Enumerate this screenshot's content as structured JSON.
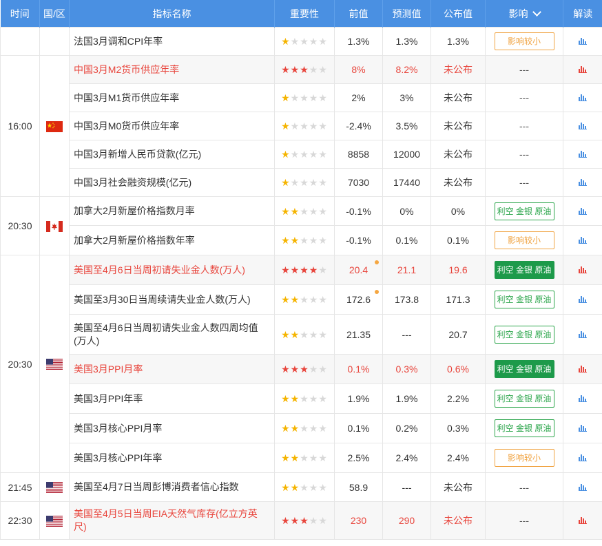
{
  "header": {
    "time": "时间",
    "region": "国/区",
    "name": "指标名称",
    "importance": "重要性",
    "previous": "前值",
    "forecast": "预测值",
    "actual": "公布值",
    "impact": "影响",
    "interpret": "解读"
  },
  "groups": [
    {
      "time": "16:00",
      "flag": "china-flag"
    },
    {
      "time": "20:30",
      "flag": "canada-flag"
    },
    {
      "time": "20:30",
      "flag": "us-flag"
    },
    {
      "time": "21:45",
      "flag": "us-flag"
    },
    {
      "time": "22:30",
      "flag": "us-flag"
    }
  ],
  "rows": [
    {
      "name": "法国3月调和CPI年率",
      "stars": 1,
      "prev": "1.3%",
      "fc": "1.3%",
      "act": "1.3%",
      "impact": "影响较小",
      "impact_style": "small",
      "hi": false
    },
    {
      "name": "中国3月M2货币供应年率",
      "stars": 3,
      "prev": "8%",
      "fc": "8.2%",
      "act": "未公布",
      "impact": "---",
      "impact_style": "none",
      "hi": true
    },
    {
      "name": "中国3月M1货币供应年率",
      "stars": 1,
      "prev": "2%",
      "fc": "3%",
      "act": "未公布",
      "impact": "---",
      "impact_style": "none",
      "hi": false
    },
    {
      "name": "中国3月M0货币供应年率",
      "stars": 1,
      "prev": "-2.4%",
      "fc": "3.5%",
      "act": "未公布",
      "impact": "---",
      "impact_style": "none",
      "hi": false
    },
    {
      "name": "中国3月新增人民币贷款(亿元)",
      "stars": 1,
      "prev": "8858",
      "fc": "12000",
      "act": "未公布",
      "impact": "---",
      "impact_style": "none",
      "hi": false
    },
    {
      "name": "中国3月社会融资规模(亿元)",
      "stars": 1,
      "prev": "7030",
      "fc": "17440",
      "act": "未公布",
      "impact": "---",
      "impact_style": "none",
      "hi": false
    },
    {
      "name": "加拿大2月新屋价格指数月率",
      "stars": 2,
      "prev": "-0.1%",
      "fc": "0%",
      "act": "0%",
      "impact": "利空 金银 原油",
      "impact_style": "out",
      "hi": false
    },
    {
      "name": "加拿大2月新屋价格指数年率",
      "stars": 2,
      "prev": "-0.1%",
      "fc": "0.1%",
      "act": "0.1%",
      "impact": "影响较小",
      "impact_style": "small",
      "hi": false
    },
    {
      "name": "美国至4月6日当周初请失业金人数(万人)",
      "stars": 4,
      "prev": "20.4",
      "fc": "21.1",
      "act": "19.6",
      "impact": "利空 金银 原油",
      "impact_style": "fill",
      "hi": true,
      "dot": true
    },
    {
      "name": "美国至3月30日当周续请失业金人数(万人)",
      "stars": 2,
      "prev": "172.6",
      "fc": "173.8",
      "act": "171.3",
      "impact": "利空 金银 原油",
      "impact_style": "out",
      "hi": false,
      "dot": true
    },
    {
      "name": "美国至4月6日当周初请失业金人数四周均值(万人)",
      "stars": 2,
      "prev": "21.35",
      "fc": "---",
      "act": "20.7",
      "impact": "利空 金银 原油",
      "impact_style": "out",
      "hi": false
    },
    {
      "name": "美国3月PPI月率",
      "stars": 3,
      "prev": "0.1%",
      "fc": "0.3%",
      "act": "0.6%",
      "impact": "利空 金银 原油",
      "impact_style": "fill",
      "hi": true
    },
    {
      "name": "美国3月PPI年率",
      "stars": 2,
      "prev": "1.9%",
      "fc": "1.9%",
      "act": "2.2%",
      "impact": "利空 金银 原油",
      "impact_style": "out",
      "hi": false
    },
    {
      "name": "美国3月核心PPI月率",
      "stars": 2,
      "prev": "0.1%",
      "fc": "0.2%",
      "act": "0.3%",
      "impact": "利空 金银 原油",
      "impact_style": "out",
      "hi": false
    },
    {
      "name": "美国3月核心PPI年率",
      "stars": 2,
      "prev": "2.5%",
      "fc": "2.4%",
      "act": "2.4%",
      "impact": "影响较小",
      "impact_style": "small",
      "hi": false
    },
    {
      "name": "美国至4月7日当周彭博消费者信心指数",
      "stars": 2,
      "prev": "58.9",
      "fc": "---",
      "act": "未公布",
      "impact": "---",
      "impact_style": "none",
      "hi": false
    },
    {
      "name": "美国至4月5日当周EIA天然气库存(亿立方英尺)",
      "stars": 3,
      "prev": "230",
      "fc": "290",
      "act": "未公布",
      "impact": "---",
      "impact_style": "none",
      "hi": true
    }
  ],
  "colors": {
    "header": "#4a90e2",
    "highlight_red": "#e8453c",
    "star": "#f5b400",
    "bullish_green": "#1d9a4a",
    "minor_orange": "#f0a341"
  }
}
